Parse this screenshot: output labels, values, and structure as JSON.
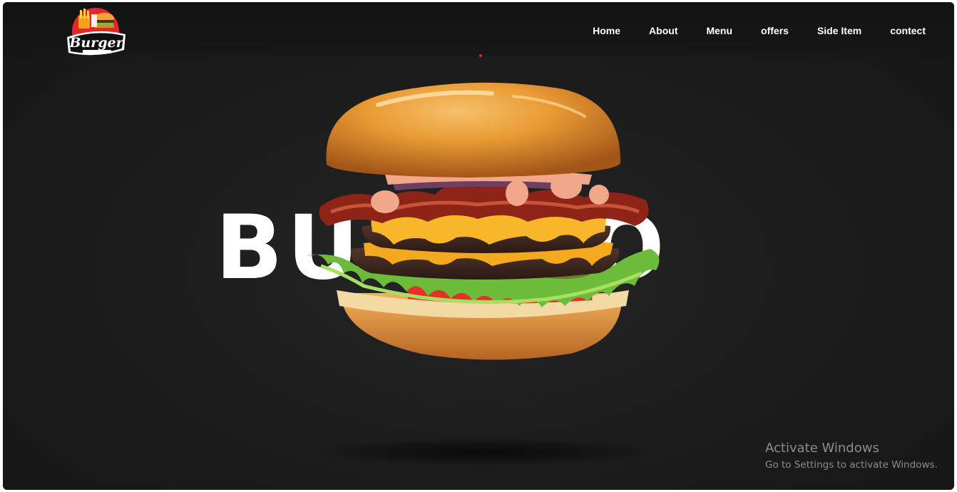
{
  "brand": {
    "logo_name": "Burger",
    "logo_alt": "Burger logo"
  },
  "nav": {
    "items": [
      {
        "label": "Home"
      },
      {
        "label": "About"
      },
      {
        "label": "Menu"
      },
      {
        "label": "offers"
      },
      {
        "label": "Side Item"
      },
      {
        "label": "contect"
      }
    ]
  },
  "hero": {
    "headline": "BURGGO",
    "image_alt": "Cheeseburger with bacon, lettuce and tomato"
  },
  "watermark": {
    "title": "Activate Windows",
    "subtitle": "Go to Settings to activate Windows."
  },
  "colors": {
    "background": "#1d1d1d",
    "text": "#ffffff",
    "accent_red": "#e4252a"
  }
}
